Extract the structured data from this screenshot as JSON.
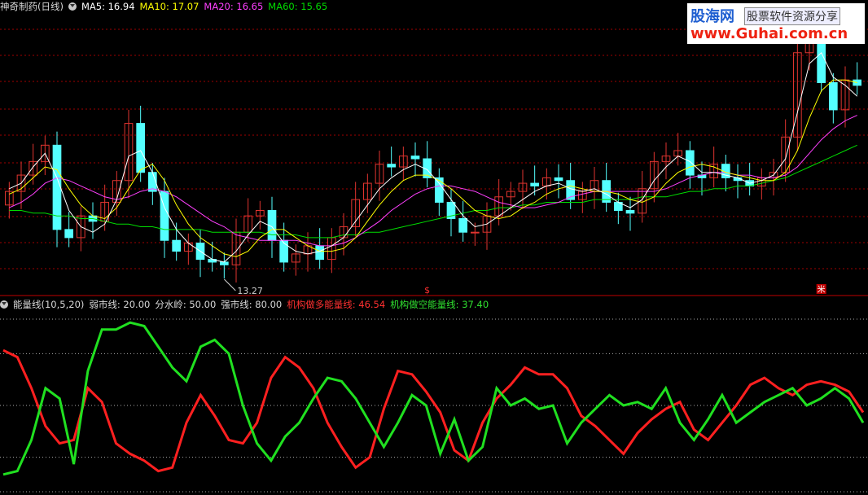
{
  "colors": {
    "background": "#000000",
    "up": "#e0342f",
    "down": "#54ffff",
    "ma5": "#ffffff",
    "ma10": "#ffff00",
    "ma20": "#ff40ff",
    "ma60": "#00dd00",
    "bull": "#ff2020",
    "bear": "#20e020",
    "grid": "#a00000"
  },
  "header_top": {
    "title": "神奇制药(日线)",
    "dropdown_icon": "chevron-down-icon",
    "ma5": "MA5: 16.94",
    "ma10": "MA10: 17.07",
    "ma20": "MA20: 16.65",
    "ma60": "MA60: 15.65"
  },
  "header_bottom": {
    "indicator": "能量线(10,5,20)",
    "weak": "弱市线: 20.00",
    "water": "分水岭: 50.00",
    "strong": "强市线: 80.00",
    "bull_label": "机构做多能量线: 46.54",
    "bear_label": "机构做空能量线: 37.40"
  },
  "watermark": {
    "title": "股海网",
    "subtitle": "股票软件资源分享",
    "url": "www.Guhai.com.cn"
  },
  "chart_data": [
    {
      "type": "candlestick",
      "title": "神奇制药(日线)",
      "annotations": [
        "13.27",
        "$",
        "米"
      ],
      "series": [
        {
          "name": "MA5",
          "value": 16.94
        },
        {
          "name": "MA10",
          "value": 17.07
        },
        {
          "name": "MA20",
          "value": 16.65
        },
        {
          "name": "MA60",
          "value": 15.65
        }
      ],
      "low_marker": 13.27,
      "ma5": [
        16.6,
        16.8,
        17.4,
        17.9,
        17.0,
        15.8,
        15.2,
        15.0,
        15.3,
        16.2,
        17.8,
        18.0,
        17.2,
        15.9,
        15.1,
        14.6,
        14.3,
        14.0,
        13.9,
        14.3,
        14.9,
        15.4,
        15.2,
        14.6,
        14.3,
        14.2,
        14.3,
        14.5,
        14.8,
        15.4,
        16.0,
        16.6,
        17.0,
        17.3,
        17.5,
        17.3,
        16.8,
        16.2,
        15.6,
        15.2,
        15.3,
        15.6,
        15.9,
        16.2,
        16.5,
        16.7,
        16.8,
        16.6,
        16.5,
        16.6,
        16.4,
        16.1,
        15.9,
        16.2,
        16.9,
        17.4,
        17.8,
        17.6,
        17.2,
        17.2,
        17.1,
        17.0,
        16.8,
        16.9,
        17.1,
        17.7,
        19.4,
        21.2,
        21.6,
        20.7,
        20.4,
        20.0
      ],
      "ma10": [
        16.4,
        16.6,
        17.0,
        17.4,
        17.3,
        16.6,
        16.0,
        15.6,
        15.5,
        15.9,
        16.6,
        17.3,
        17.5,
        16.9,
        16.0,
        15.3,
        14.8,
        14.5,
        14.2,
        14.1,
        14.3,
        14.8,
        15.1,
        15.1,
        14.8,
        14.5,
        14.3,
        14.3,
        14.4,
        14.8,
        15.4,
        16.0,
        16.5,
        16.9,
        17.1,
        17.1,
        16.9,
        16.6,
        16.2,
        15.8,
        15.6,
        15.5,
        15.6,
        15.9,
        16.1,
        16.4,
        16.6,
        16.7,
        16.6,
        16.5,
        16.5,
        16.4,
        16.2,
        16.1,
        16.3,
        16.8,
        17.2,
        17.4,
        17.5,
        17.4,
        17.2,
        17.1,
        17.0,
        16.9,
        16.9,
        17.2,
        18.0,
        19.2,
        20.2,
        20.6,
        20.6,
        20.5
      ],
      "ma20": [
        15.9,
        16.1,
        16.4,
        16.8,
        17.0,
        16.9,
        16.7,
        16.5,
        16.3,
        16.2,
        16.3,
        16.5,
        16.6,
        16.5,
        16.3,
        16.0,
        15.7,
        15.4,
        15.2,
        14.9,
        14.8,
        14.7,
        14.7,
        14.7,
        14.7,
        14.6,
        14.5,
        14.5,
        14.6,
        14.8,
        15.1,
        15.4,
        15.8,
        16.1,
        16.4,
        16.6,
        16.7,
        16.7,
        16.6,
        16.5,
        16.3,
        16.1,
        16.0,
        15.9,
        15.9,
        16.0,
        16.1,
        16.3,
        16.4,
        16.5,
        16.5,
        16.5,
        16.5,
        16.5,
        16.5,
        16.6,
        16.8,
        17.0,
        17.1,
        17.2,
        17.2,
        17.1,
        17.1,
        17.0,
        17.0,
        17.1,
        17.4,
        17.9,
        18.4,
        18.8,
        19.1,
        19.3
      ],
      "ma60": [
        15.8,
        15.8,
        15.7,
        15.7,
        15.6,
        15.6,
        15.5,
        15.5,
        15.4,
        15.3,
        15.3,
        15.2,
        15.2,
        15.1,
        15.1,
        15.1,
        15.1,
        15.0,
        15.0,
        15.0,
        15.0,
        15.0,
        14.9,
        14.9,
        14.9,
        14.8,
        14.8,
        14.8,
        14.9,
        14.9,
        15.0,
        15.0,
        15.1,
        15.2,
        15.3,
        15.4,
        15.5,
        15.6,
        15.7,
        15.8,
        15.8,
        15.9,
        15.9,
        16.0,
        16.0,
        16.1,
        16.1,
        16.1,
        16.1,
        16.2,
        16.2,
        16.2,
        16.2,
        16.3,
        16.3,
        16.3,
        16.4,
        16.5,
        16.5,
        16.6,
        16.6,
        16.7,
        16.7,
        16.8,
        16.9,
        17.0,
        17.2,
        17.4,
        17.6,
        17.8,
        18.0,
        18.2
      ],
      "close": [
        16.5,
        17.1,
        17.6,
        18.2,
        15.1,
        14.8,
        15.6,
        15.4,
        16.1,
        16.9,
        19.0,
        17.2,
        16.5,
        14.7,
        14.3,
        14.6,
        14.0,
        13.9,
        13.8,
        15.0,
        15.6,
        15.8,
        14.7,
        13.9,
        14.2,
        14.5,
        14.0,
        14.8,
        15.2,
        16.2,
        16.8,
        17.5,
        17.4,
        17.8,
        17.7,
        17.0,
        16.1,
        15.5,
        15.0,
        15.0,
        15.6,
        16.3,
        16.5,
        16.8,
        16.7,
        17.0,
        16.9,
        16.2,
        16.5,
        16.9,
        16.1,
        15.8,
        15.7,
        16.6,
        17.6,
        17.8,
        18.0,
        17.1,
        17.0,
        17.5,
        17.0,
        16.9,
        16.7,
        17.0,
        17.2,
        18.5,
        21.6,
        22.3,
        20.5,
        19.5,
        20.6,
        20.4
      ],
      "open": [
        16.0,
        16.5,
        17.1,
        17.6,
        18.2,
        15.1,
        14.8,
        15.6,
        15.4,
        16.1,
        16.9,
        19.0,
        17.2,
        16.5,
        14.7,
        14.3,
        14.6,
        14.0,
        13.9,
        13.8,
        15.0,
        15.6,
        15.8,
        14.7,
        13.9,
        14.2,
        14.5,
        14.0,
        14.8,
        15.2,
        16.2,
        16.8,
        17.5,
        17.4,
        17.8,
        17.7,
        17.0,
        16.1,
        15.5,
        15.0,
        15.0,
        15.6,
        16.3,
        16.5,
        16.8,
        16.7,
        17.0,
        16.9,
        16.2,
        16.5,
        16.9,
        16.1,
        15.8,
        15.7,
        16.6,
        17.6,
        17.8,
        18.0,
        17.1,
        17.0,
        17.5,
        17.0,
        16.9,
        16.7,
        17.0,
        17.2,
        18.5,
        21.6,
        22.3,
        20.5,
        19.5,
        20.6
      ],
      "energy_indicator": {
        "name": "能量线(10,5,20)",
        "y_range": [
          0,
          100
        ],
        "levels": [
          20,
          50,
          80
        ],
        "series": [
          {
            "name": "机构做多能量线",
            "last": 46.54,
            "values": [
              82,
              78,
              60,
              38,
              28,
              30,
              60,
              52,
              28,
              22,
              18,
              12,
              14,
              40,
              56,
              44,
              30,
              28,
              40,
              66,
              78,
              72,
              60,
              40,
              26,
              14,
              20,
              48,
              70,
              68,
              58,
              46,
              24,
              18,
              40,
              54,
              62,
              72,
              68,
              68,
              60,
              44,
              38,
              30,
              22,
              34,
              42,
              48,
              52,
              36,
              30,
              40,
              50,
              62,
              66,
              60,
              56,
              62,
              64,
              62,
              58,
              46
            ]
          },
          {
            "name": "机构做空能量线",
            "last": 37.4,
            "values": [
              10,
              12,
              30,
              60,
              54,
              16,
              70,
              94,
              94,
              98,
              96,
              84,
              72,
              64,
              84,
              88,
              80,
              50,
              28,
              18,
              32,
              40,
              54,
              66,
              64,
              54,
              40,
              26,
              40,
              56,
              50,
              22,
              42,
              18,
              26,
              60,
              50,
              54,
              48,
              50,
              28,
              40,
              48,
              56,
              50,
              52,
              48,
              60,
              40,
              30,
              42,
              56,
              40,
              46,
              52,
              56,
              60,
              50,
              54,
              60,
              54,
              40
            ]
          }
        ]
      }
    }
  ]
}
